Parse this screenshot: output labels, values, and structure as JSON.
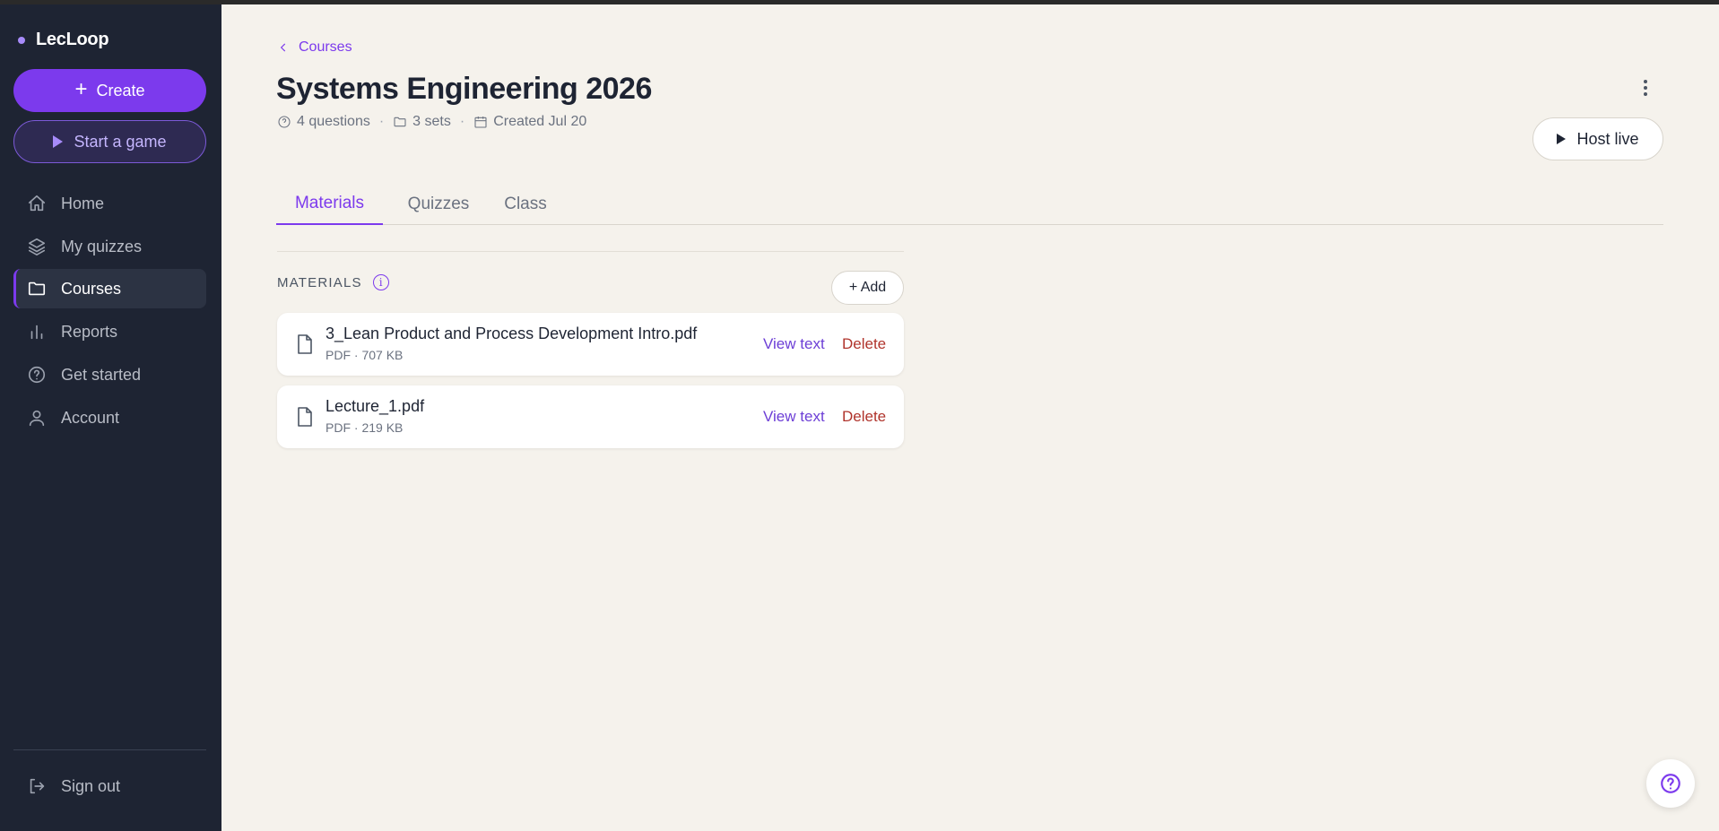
{
  "app": {
    "name": "LecLoop"
  },
  "sidebar": {
    "create_label": "Create",
    "start_game_label": "Start a game",
    "items": [
      {
        "label": "Home",
        "icon": "home-icon"
      },
      {
        "label": "My quizzes",
        "icon": "layers-icon"
      },
      {
        "label": "Courses",
        "icon": "folder-icon",
        "active": true
      },
      {
        "label": "Reports",
        "icon": "bar-chart-icon"
      },
      {
        "label": "Get started",
        "icon": "help-circle-icon"
      },
      {
        "label": "Account",
        "icon": "user-icon"
      }
    ],
    "sign_out_label": "Sign out"
  },
  "header": {
    "breadcrumb": "Courses",
    "title": "Systems Engineering 2026",
    "meta": {
      "questions": "4 questions",
      "sets": "3 sets",
      "created": "Created Jul 20"
    },
    "host_live_label": "Host live"
  },
  "tabs": [
    {
      "label": "Materials",
      "active": true
    },
    {
      "label": "Quizzes"
    },
    {
      "label": "Class"
    }
  ],
  "materials": {
    "section_title": "MATERIALS",
    "add_label": "+ Add",
    "files": [
      {
        "name": "3_Lean Product and Process Development Intro.pdf",
        "meta": "PDF · 707 KB",
        "view_label": "View text",
        "delete_label": "Delete"
      },
      {
        "name": "Lecture_1.pdf",
        "meta": "PDF · 219 KB",
        "view_label": "View text",
        "delete_label": "Delete"
      }
    ]
  },
  "colors": {
    "accent": "#7c3aed",
    "sidebar_bg": "#1e2433",
    "page_bg": "#f5f2ec",
    "danger": "#b0342c"
  }
}
